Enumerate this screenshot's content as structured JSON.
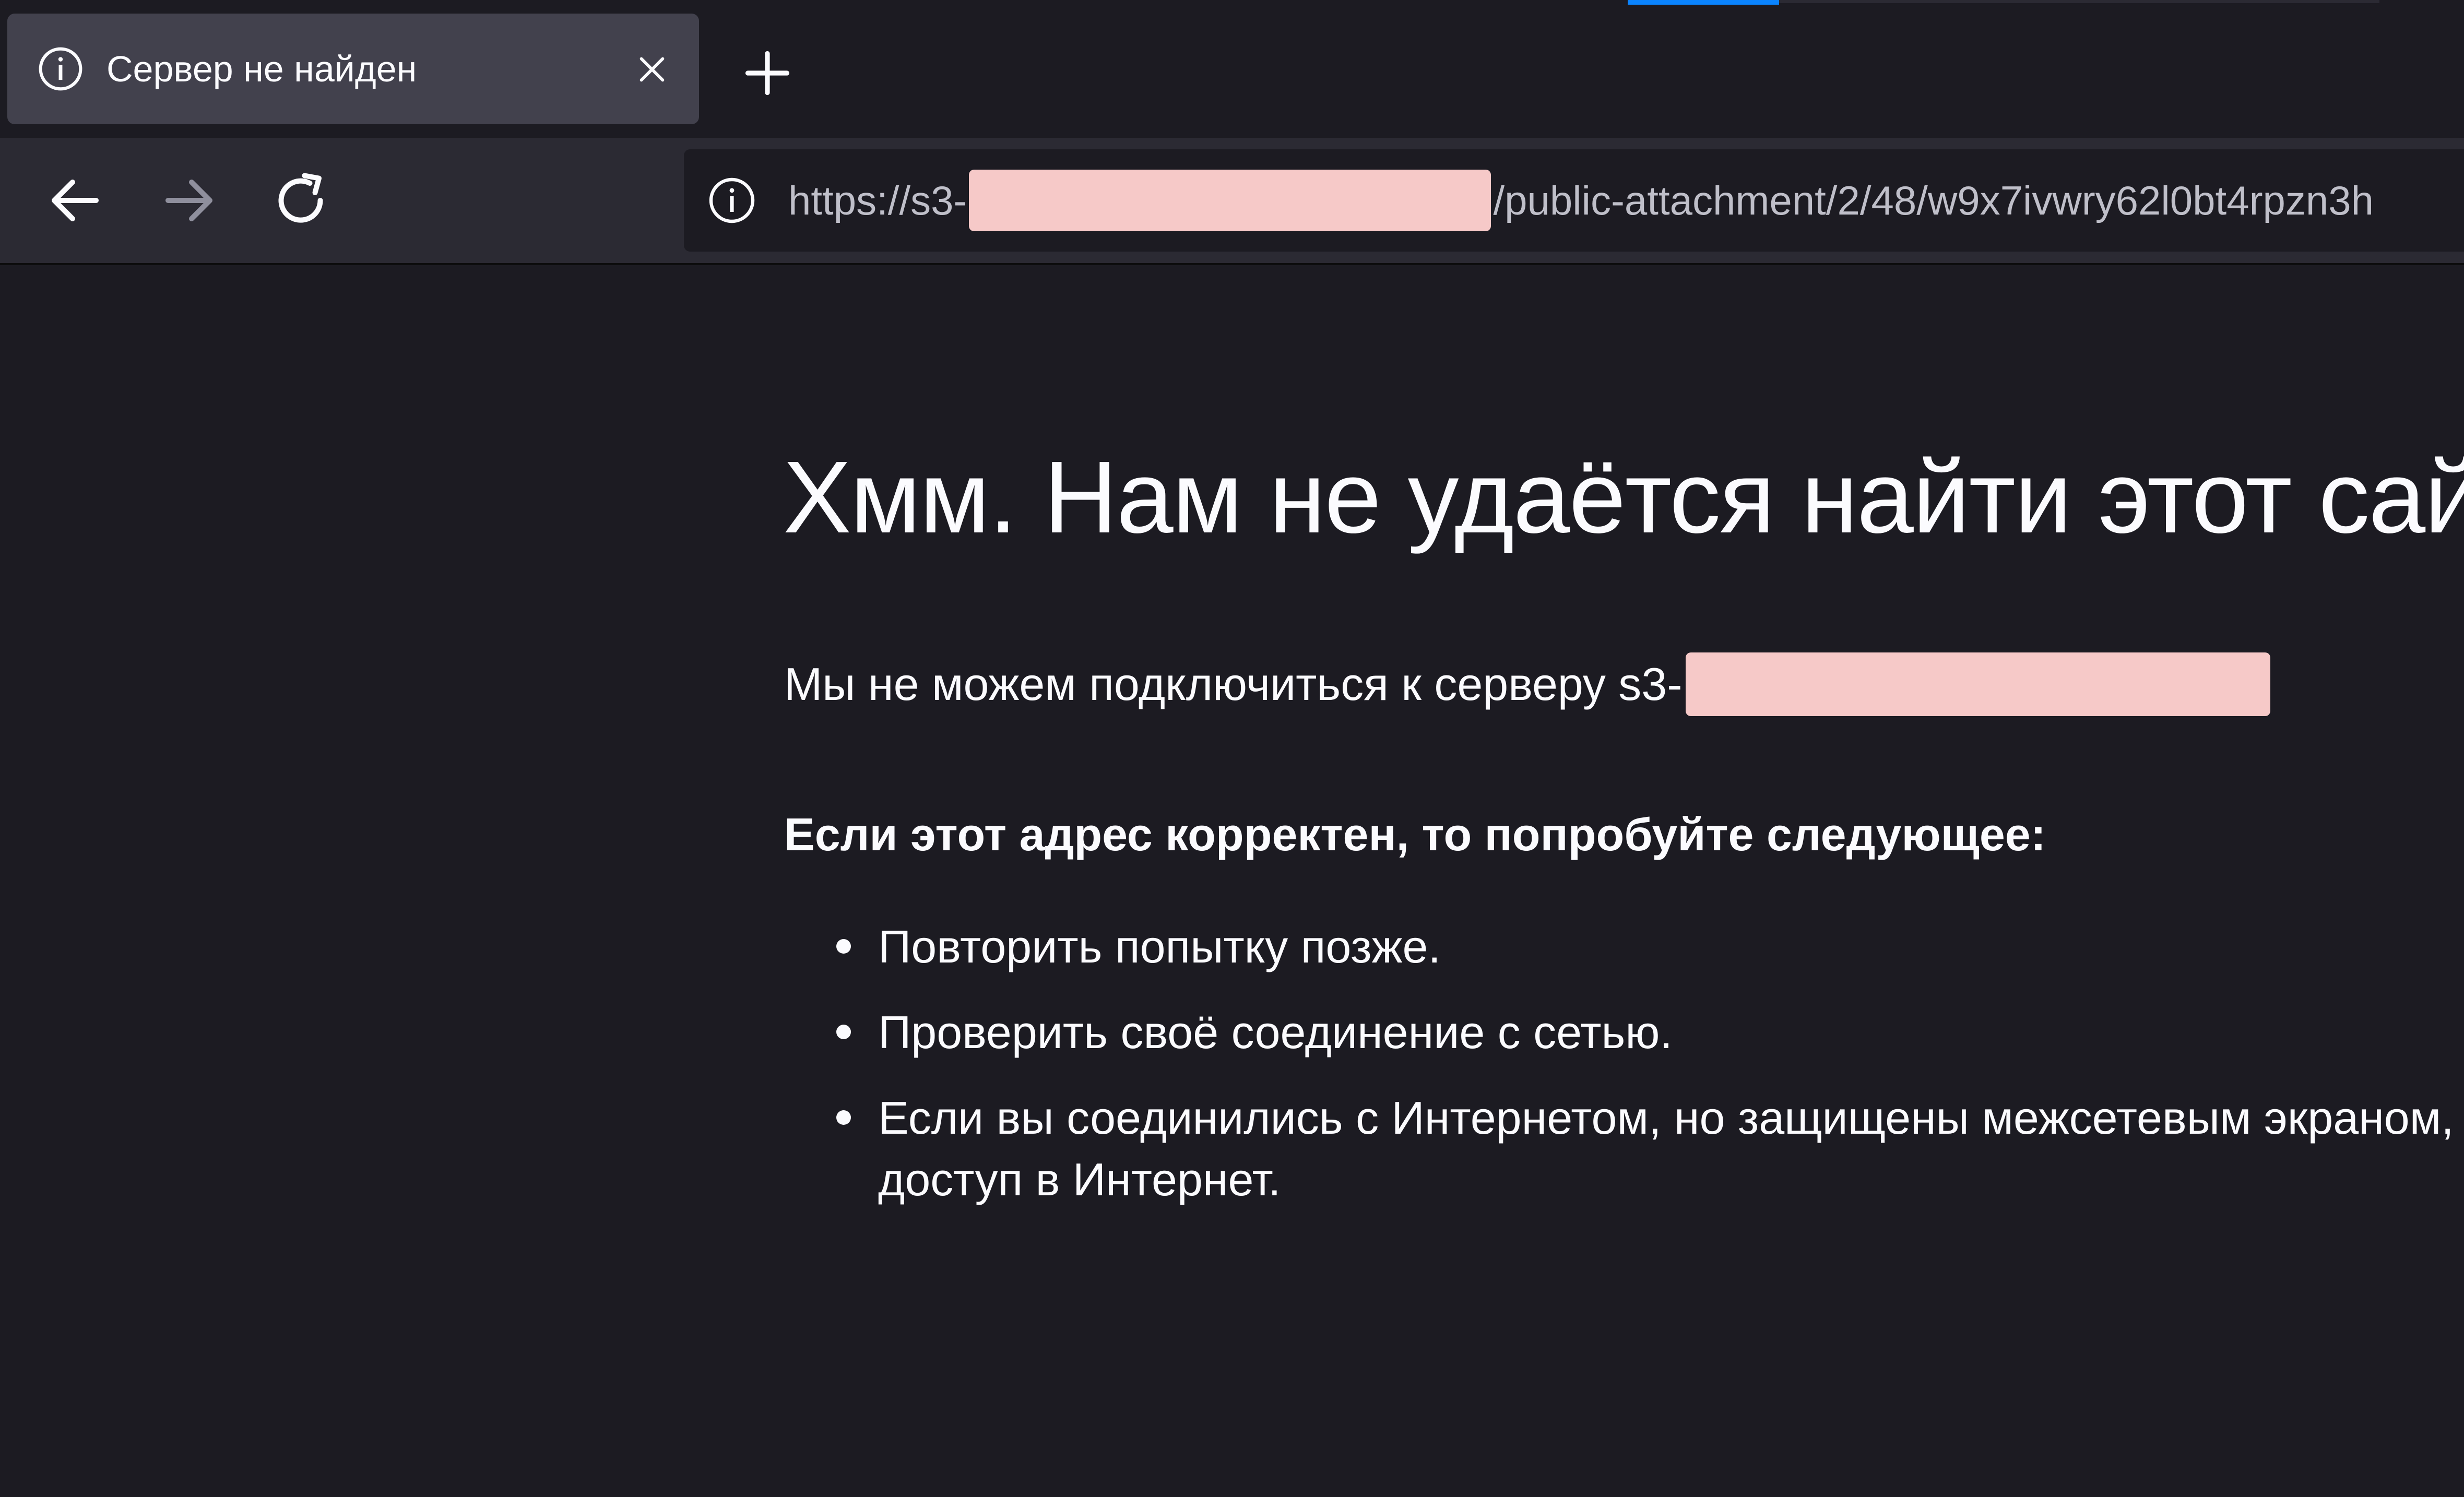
{
  "tab": {
    "title": "Сервер не найден",
    "icon": "info-icon",
    "close_icon": "close-icon"
  },
  "new_tab_icon": "plus-icon",
  "nav": {
    "back_icon": "arrow-left-icon",
    "forward_icon": "arrow-right-icon",
    "reload_icon": "reload-icon"
  },
  "urlbar": {
    "icon": "info-icon",
    "prefix": "https://s3-",
    "suffix": "/public-attachment/2/48/w9x7ivwry62l0bt4rpzn3h"
  },
  "page": {
    "title": "Хмм. Нам не удаётся найти этот сайт.",
    "description": "Мы не можем подключиться к серверу s3-",
    "suggestions_heading": "Если этот адрес корректен, то попробуйте следующее:",
    "suggestions": [
      "Повторить попытку позже.",
      "Проверить своё соединение с сетью."
    ],
    "suggestion_3_line1": "Если вы соединились с Интернетом, но защищены межсетевым экраном,",
    "suggestion_3_line2": "доступ в Интернет."
  },
  "colors": {
    "background": "#1c1b22",
    "toolbar": "#2b2a33",
    "tab_selected": "#42414d",
    "text": "#fbfbfe",
    "redaction": "#f6c9c8",
    "accent": "#0a84ff"
  }
}
